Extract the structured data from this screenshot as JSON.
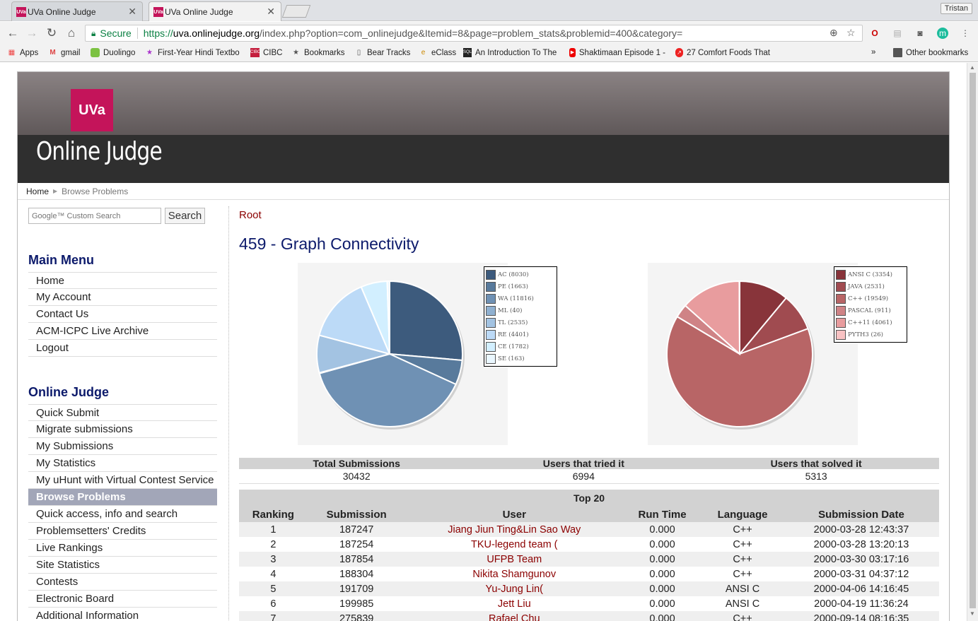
{
  "browser": {
    "tabs": [
      {
        "title": "UVa Online Judge"
      },
      {
        "title": "UVa Online Judge"
      }
    ],
    "profile_name": "Tristan",
    "secure_label": "Secure",
    "url_proto": "https://",
    "url_host": "uva.onlinejudge.org",
    "url_path": "/index.php?option=com_onlinejudge&Itemid=8&page=problem_stats&problemid=400&category=",
    "bookmarks": [
      {
        "label": "Apps"
      },
      {
        "label": "gmail"
      },
      {
        "label": "Duolingo"
      },
      {
        "label": "First-Year Hindi Textbo"
      },
      {
        "label": "CIBC"
      },
      {
        "label": "Bookmarks"
      },
      {
        "label": "Bear Tracks"
      },
      {
        "label": "eClass"
      },
      {
        "label": "An Introduction To The \""
      },
      {
        "label": "Shaktimaan Episode 1 -"
      },
      {
        "label": "27 Comfort Foods That"
      }
    ],
    "overflow_label": "»",
    "other_bookmarks": "Other bookmarks"
  },
  "site": {
    "logo_text": "UVa",
    "title": "Online Judge",
    "breadcrumb_home": "Home",
    "breadcrumb_current": "Browse Problems",
    "search_placeholder": "Google™ Custom Search",
    "search_button": "Search"
  },
  "sidebar": {
    "main_menu_title": "Main Menu",
    "main_menu": [
      "Home",
      "My Account",
      "Contact Us",
      "ACM-ICPC Live Archive",
      "Logout"
    ],
    "judge_menu_title": "Online Judge",
    "judge_menu": [
      "Quick Submit",
      "Migrate submissions",
      "My Submissions",
      "My Statistics",
      "My uHunt with Virtual Contest Service",
      "Browse Problems",
      "Quick access, info and search",
      "Problemsetters' Credits",
      "Live Rankings",
      "Site Statistics",
      "Contests",
      "Electronic Board",
      "Additional Information"
    ],
    "active_item": "Browse Problems"
  },
  "content": {
    "root_link": "Root",
    "problem_title": "459 - Graph Connectivity",
    "stats_headers": [
      "Total Submissions",
      "Users that tried it",
      "Users that solved it"
    ],
    "stats_values": [
      "30432",
      "6994",
      "5313"
    ],
    "top_caption": "Top 20",
    "top_headers": [
      "Ranking",
      "Submission",
      "User",
      "Run Time",
      "Language",
      "Submission Date"
    ],
    "top_rows": [
      [
        "1",
        "187247",
        "Jiang Jiun Ting&Lin Sao Way",
        "0.000",
        "C++",
        "2000-03-28 12:43:37"
      ],
      [
        "2",
        "187254",
        "TKU-legend team (",
        "0.000",
        "C++",
        "2000-03-28 13:20:13"
      ],
      [
        "3",
        "187854",
        "UFPB Team",
        "0.000",
        "C++",
        "2000-03-30 03:17:16"
      ],
      [
        "4",
        "188304",
        "Nikita Shamgunov",
        "0.000",
        "C++",
        "2000-03-31 04:37:12"
      ],
      [
        "5",
        "191709",
        "Yu-Jung Lin(",
        "0.000",
        "ANSI C",
        "2000-04-06 14:16:45"
      ],
      [
        "6",
        "199985",
        "Jett Liu",
        "0.000",
        "ANSI C",
        "2000-04-19 11:36:24"
      ],
      [
        "7",
        "275839",
        "Rafael Chu",
        "0.000",
        "C++",
        "2000-09-14 08:16:35"
      ]
    ]
  },
  "chart_data": [
    {
      "type": "pie",
      "title": "",
      "categories": [
        "AC",
        "PE",
        "WA",
        "ML",
        "TL",
        "RE",
        "CE",
        "SE"
      ],
      "values": [
        8030,
        1663,
        11816,
        40,
        2535,
        4401,
        1782,
        163
      ],
      "legend": [
        "AC (8030)",
        "PE (1663)",
        "WA (11816)",
        "ML (40)",
        "TL (2535)",
        "RE (4401)",
        "CE (1782)",
        "SE (163)"
      ],
      "colors": [
        "#3d5b7d",
        "#587a9c",
        "#6f91b4",
        "#8fb0d0",
        "#a3c3e2",
        "#bcdaf7",
        "#d2efff",
        "#eaf7ff"
      ],
      "legend_position": "top-right"
    },
    {
      "type": "pie",
      "title": "",
      "categories": [
        "ANSI C",
        "JAVA",
        "C++",
        "PASCAL",
        "C++11",
        "PYTH3"
      ],
      "values": [
        3354,
        2531,
        19549,
        911,
        4061,
        26
      ],
      "legend": [
        "ANSI C (3354)",
        "JAVA (2531)",
        "C++ (19549)",
        "PASCAL (911)",
        "C++11 (4061)",
        "PYTH3 (26)"
      ],
      "colors": [
        "#88343a",
        "#a04b50",
        "#b86566",
        "#cf8386",
        "#e89c9e",
        "#f8c2c3"
      ],
      "legend_position": "top-right"
    }
  ]
}
